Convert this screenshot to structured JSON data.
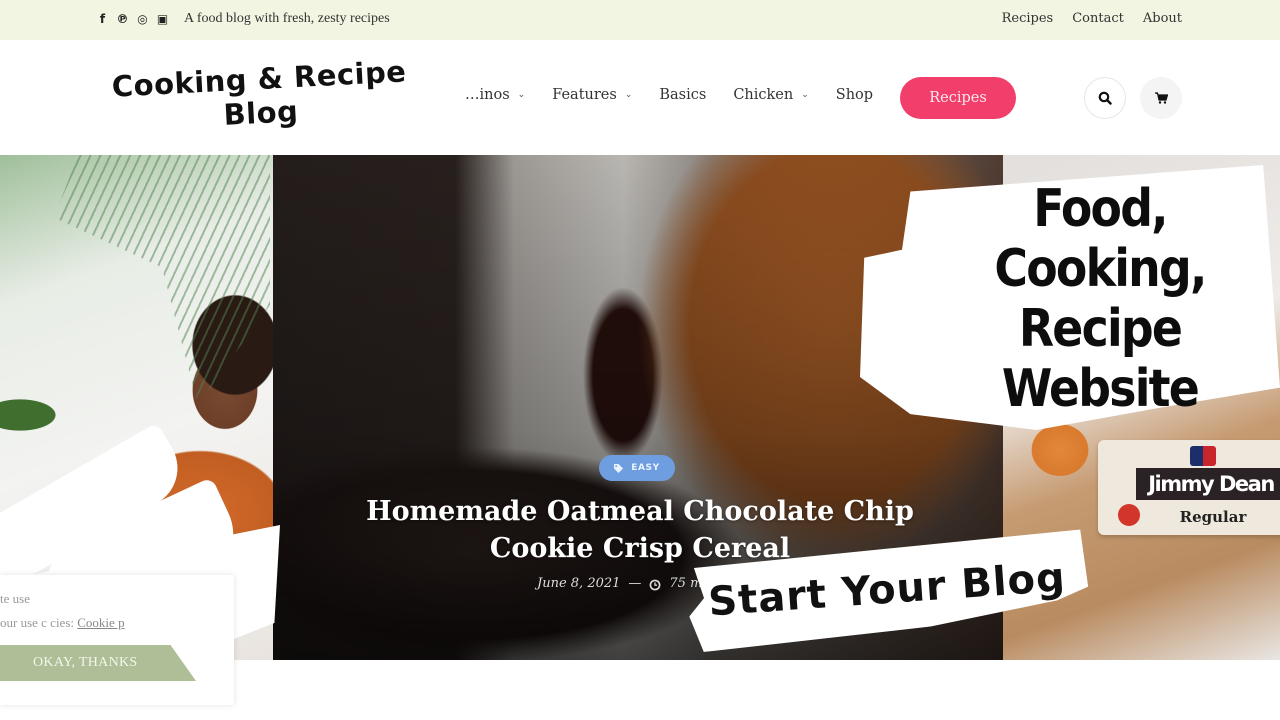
{
  "topbar": {
    "social_icons": [
      {
        "name": "facebook-icon",
        "glyph": "f"
      },
      {
        "name": "pinterest-icon",
        "glyph": "℗"
      },
      {
        "name": "instagram-icon",
        "glyph": "◎"
      },
      {
        "name": "youtube-icon",
        "glyph": "▣"
      }
    ],
    "tagline": "A food blog with fresh, zesty recipes",
    "links": [
      "Recipes",
      "Contact",
      "About"
    ]
  },
  "header": {
    "logo_line1": "Cooking & Recipe",
    "logo_line2": "Blog",
    "nav": [
      {
        "label": "…inos",
        "has_dropdown": true
      },
      {
        "label": "Features",
        "has_dropdown": true
      },
      {
        "label": "Basics",
        "has_dropdown": false
      },
      {
        "label": "Chicken",
        "has_dropdown": true
      },
      {
        "label": "Shop",
        "has_dropdown": false
      }
    ],
    "cta_label": "Recipes",
    "chevron": "⌄",
    "search_icon": "search-icon",
    "cart_icon": "cart-icon"
  },
  "hero": {
    "post": {
      "tag": "EASY",
      "title": "Homemade Oatmeal Chocolate Chip Cookie Crisp Cereal",
      "date": "June 8, 2021",
      "separator": "—",
      "read_time": "75 m"
    },
    "product_label": "Jimmy Dean",
    "product_sub": "Regular",
    "promo_headline": [
      "Food,",
      "Cooking,",
      "Recipe",
      "Website"
    ],
    "promo_banner": "Start Your Blog"
  },
  "cookie_notice": {
    "line1": "te use",
    "line2_prefix": "our use c        cies:",
    "link_text": "Cookie p",
    "button_label": "OKAY, THANKS"
  },
  "colors": {
    "topbar_bg": "#f1f5e1",
    "cta_pink": "#f23e6a",
    "tag_blue": "#6f9ee0",
    "cookie_button": "#aebf97"
  }
}
